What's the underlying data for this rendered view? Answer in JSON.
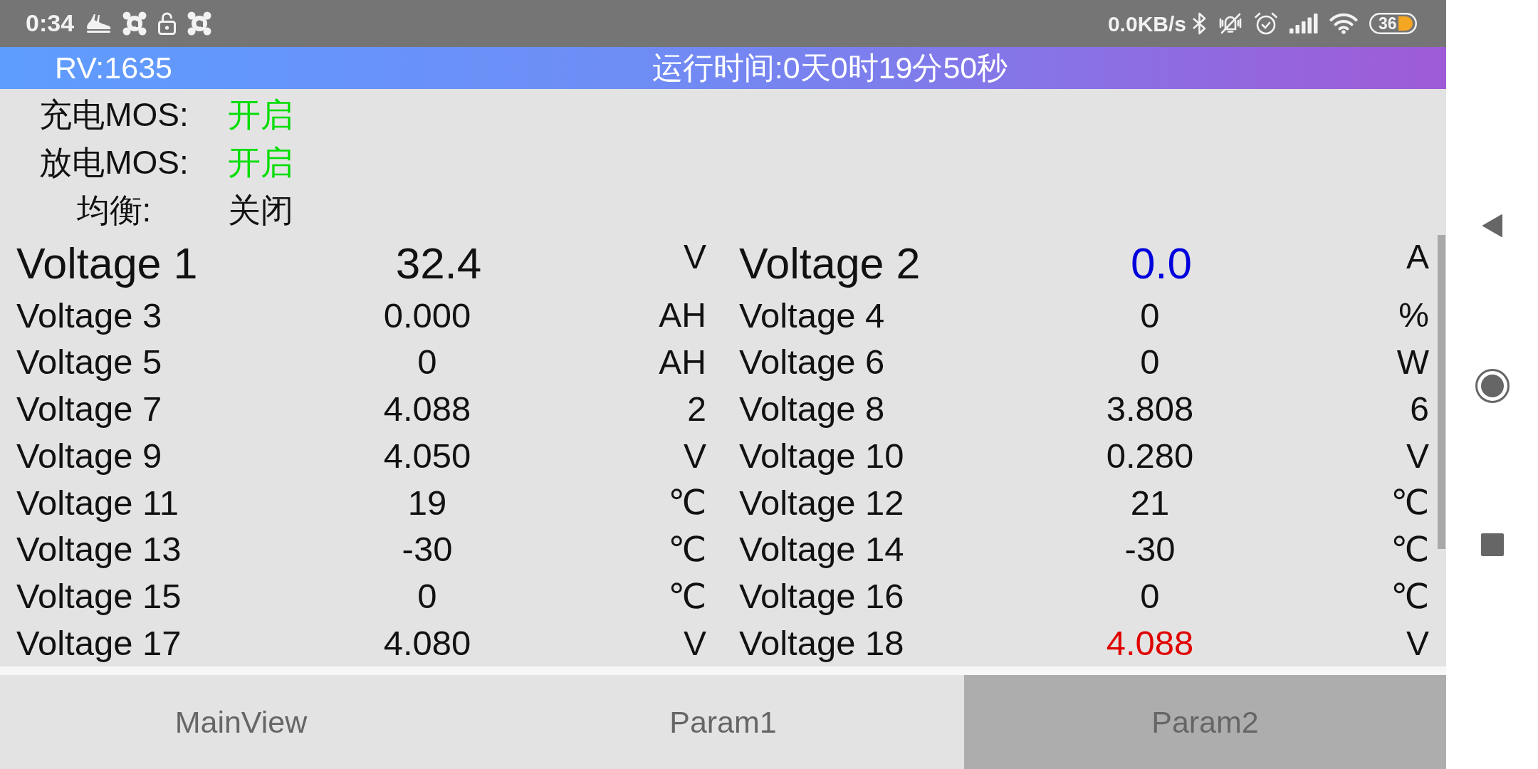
{
  "status_bar": {
    "time": "0:34",
    "network_speed": "0.0KB/s",
    "battery_percent": "36"
  },
  "header": {
    "version": "RV:1635",
    "run_time": "运行时间:0天0时19分50秒"
  },
  "mos_status": [
    {
      "label": "充电MOS:",
      "value": "开启",
      "color": "#00dd00"
    },
    {
      "label": "放电MOS:",
      "value": "开启",
      "color": "#00dd00"
    },
    {
      "label": "均衡:",
      "value": "关闭",
      "color": "#111111"
    }
  ],
  "readings": [
    {
      "kind": "large",
      "cells": [
        {
          "name": "Voltage 1",
          "value": "32.4",
          "unit": "V",
          "color": "#111111"
        },
        {
          "name": "Voltage 2",
          "value": "0.0",
          "unit": "A",
          "color": "#0000dd"
        }
      ]
    },
    {
      "kind": "normal",
      "cells": [
        {
          "name": "Voltage 3",
          "value": "0.000",
          "unit": "AH",
          "color": "#111111"
        },
        {
          "name": "Voltage 4",
          "value": "0",
          "unit": "%",
          "color": "#111111"
        }
      ]
    },
    {
      "kind": "normal",
      "cells": [
        {
          "name": "Voltage 5",
          "value": "0",
          "unit": "AH",
          "color": "#111111"
        },
        {
          "name": "Voltage 6",
          "value": "0",
          "unit": "W",
          "color": "#111111"
        }
      ]
    },
    {
      "kind": "normal",
      "cells": [
        {
          "name": "Voltage 7",
          "value": "4.088",
          "unit": "2",
          "color": "#111111"
        },
        {
          "name": "Voltage 8",
          "value": "3.808",
          "unit": "6",
          "color": "#111111"
        }
      ]
    },
    {
      "kind": "normal",
      "cells": [
        {
          "name": "Voltage 9",
          "value": "4.050",
          "unit": "V",
          "color": "#111111"
        },
        {
          "name": "Voltage 10",
          "value": "0.280",
          "unit": "V",
          "color": "#111111"
        }
      ]
    },
    {
      "kind": "normal",
      "cells": [
        {
          "name": "Voltage 11",
          "value": "19",
          "unit": "℃",
          "color": "#111111"
        },
        {
          "name": "Voltage 12",
          "value": "21",
          "unit": "℃",
          "color": "#111111"
        }
      ]
    },
    {
      "kind": "normal",
      "cells": [
        {
          "name": "Voltage 13",
          "value": "-30",
          "unit": "℃",
          "color": "#111111"
        },
        {
          "name": "Voltage 14",
          "value": "-30",
          "unit": "℃",
          "color": "#111111"
        }
      ]
    },
    {
      "kind": "normal",
      "cells": [
        {
          "name": "Voltage 15",
          "value": "0",
          "unit": "℃",
          "color": "#111111"
        },
        {
          "name": "Voltage 16",
          "value": "0",
          "unit": "℃",
          "color": "#111111"
        }
      ]
    },
    {
      "kind": "normal",
      "cells": [
        {
          "name": "Voltage 17",
          "value": "4.080",
          "unit": "V",
          "color": "#111111"
        },
        {
          "name": "Voltage 18",
          "value": "4.088",
          "unit": "V",
          "color": "#e00000"
        }
      ]
    }
  ],
  "tabs": [
    {
      "label": "MainView",
      "selected": false
    },
    {
      "label": "Param1",
      "selected": false
    },
    {
      "label": "Param2",
      "selected": true
    }
  ]
}
